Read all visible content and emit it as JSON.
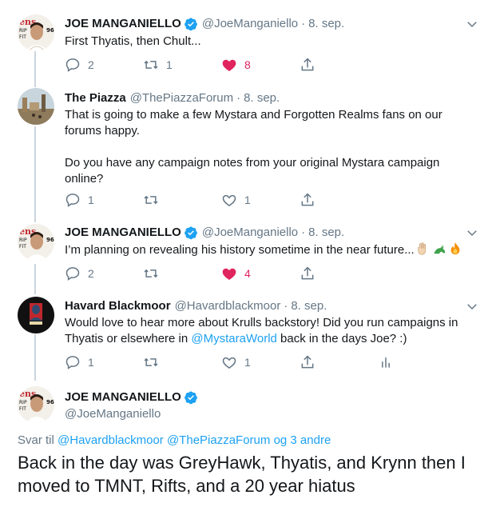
{
  "tweets": [
    {
      "name": "JOE MANGANIELLO",
      "verified": true,
      "handle": "@JoeManganiello",
      "date": "8. sep.",
      "text": "First Thyatis, then Chult...",
      "replies": "2",
      "retweets": "1",
      "likes": "8",
      "liked": true
    },
    {
      "name": "The Piazza",
      "verified": false,
      "handle": "@ThePiazzaForum",
      "date": "8. sep.",
      "text": "That is going to make a few Mystara and Forgotten Realms fans on our forums happy.\n\nDo you have any campaign notes from your original Mystara campaign online?",
      "replies": "1",
      "retweets": "",
      "likes": "1",
      "liked": false
    },
    {
      "name": "JOE MANGANIELLO",
      "verified": true,
      "handle": "@JoeManganiello",
      "date": "8. sep.",
      "text": "I’m planning on revealing his history sometime in the near future...",
      "replies": "2",
      "retweets": "",
      "likes": "4",
      "liked": true
    },
    {
      "name": "Havard Blackmoor",
      "verified": false,
      "handle": "@Havardblackmoor",
      "date": "8. sep.",
      "text_before": "Would love to hear more about Krulls backstory! Did you run campaigns in Thyatis or elsewhere in ",
      "mention": "@MystaraWorld",
      "text_after": " back in the days Joe? :)",
      "replies": "1",
      "retweets": "",
      "likes": "1",
      "liked": false
    }
  ],
  "main_tweet": {
    "name": "JOE MANGANIELLO",
    "verified": true,
    "handle": "@JoeManganiello",
    "reply_prefix": "Svar til",
    "reply_users": "@Havardblackmoor @ThePiazzaForum",
    "reply_suffix": "og 3 andre",
    "text": "Back in the day was GreyHawk, Thyatis, and Krynn then I moved to TMNT, Rifts, and a 20 year hiatus"
  },
  "colors": {
    "accent": "#1da1f2",
    "like": "#e0245e",
    "muted": "#657786",
    "thread_line": "#cbd5dc"
  },
  "icons": [
    "reply-icon",
    "retweet-icon",
    "like-icon",
    "share-icon",
    "analytics-icon",
    "verified-icon",
    "chevron-down-icon"
  ]
}
